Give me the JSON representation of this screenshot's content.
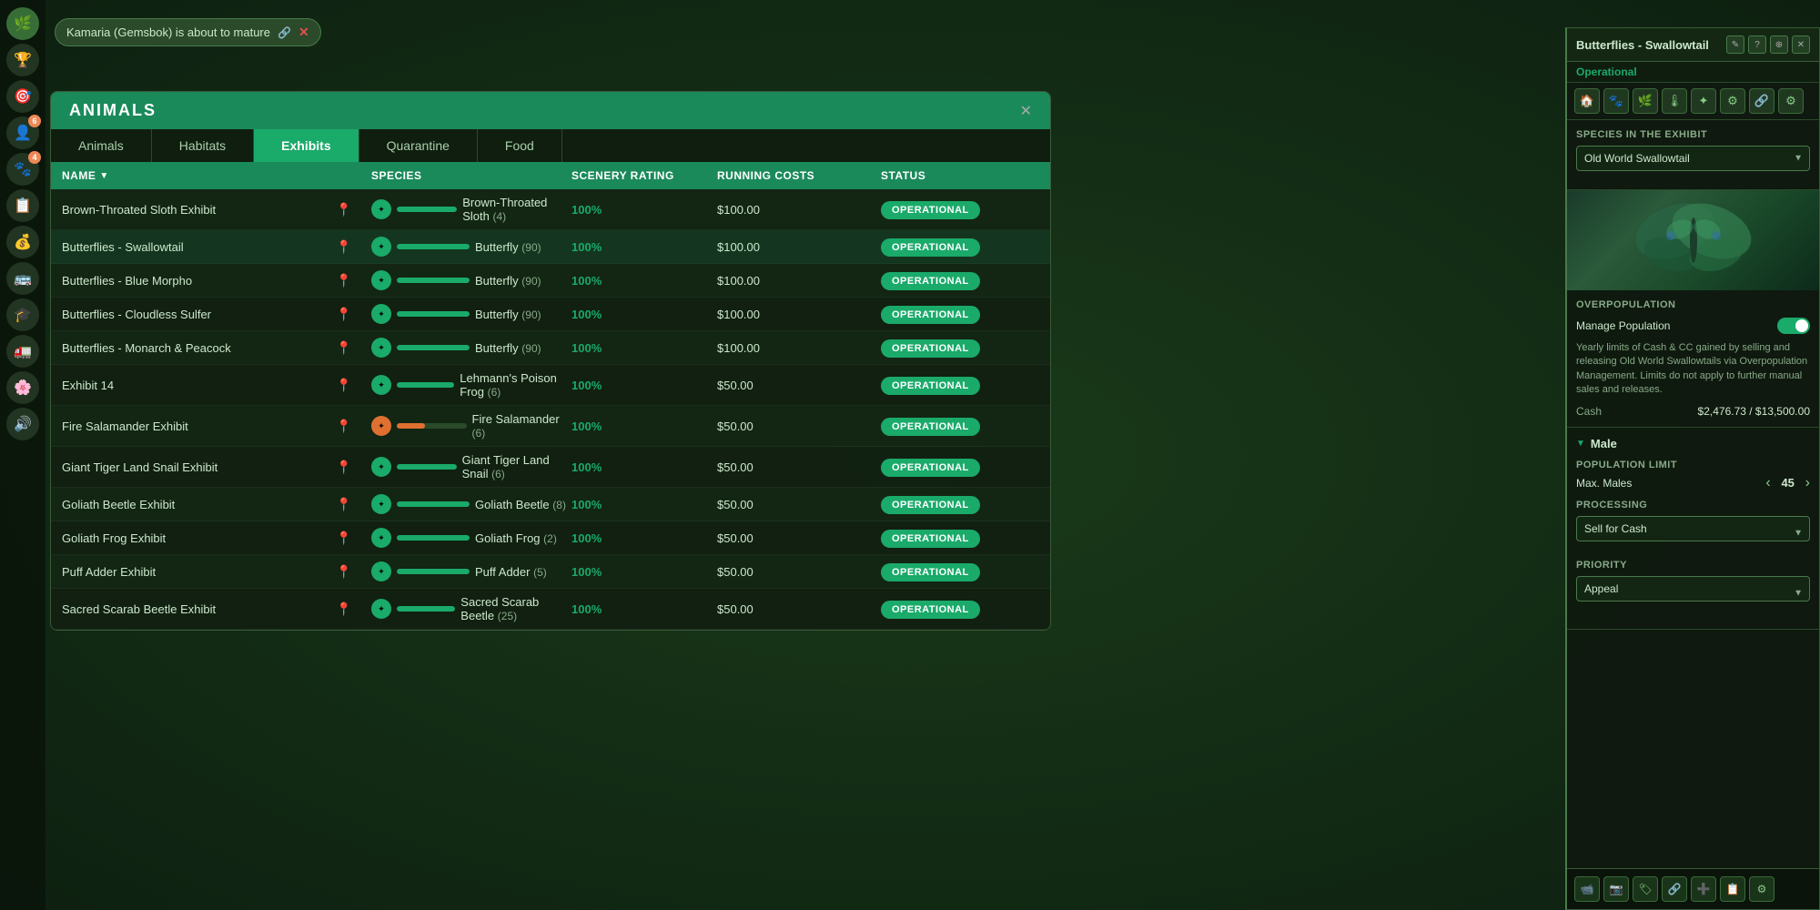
{
  "notification": {
    "text": "Kamaria (Gemsbok) is about to mature",
    "close_label": "✕"
  },
  "animals_panel": {
    "title": "ANIMALS",
    "close_label": "✕",
    "tabs": [
      {
        "label": "Animals",
        "active": false
      },
      {
        "label": "Habitats",
        "active": false
      },
      {
        "label": "Exhibits",
        "active": true
      },
      {
        "label": "Quarantine",
        "active": false
      },
      {
        "label": "Food",
        "active": false
      }
    ],
    "columns": [
      {
        "label": "NAME",
        "sortable": true
      },
      {
        "label": ""
      },
      {
        "label": "SPECIES"
      },
      {
        "label": "SCENERY RATING"
      },
      {
        "label": "RUNNING COSTS"
      },
      {
        "label": "STATUS"
      }
    ],
    "rows": [
      {
        "name": "Brown-Throated Sloth Exhibit",
        "species": "Brown-Throated Sloth",
        "count": 4,
        "scenery": "100%",
        "cost": "$100.00",
        "status": "OPERATIONAL",
        "circle_type": "green",
        "progress": 100
      },
      {
        "name": "Butterflies - Swallowtail",
        "species": "Butterfly",
        "count": 90,
        "scenery": "100%",
        "cost": "$100.00",
        "status": "OPERATIONAL",
        "circle_type": "green",
        "progress": 100,
        "highlighted": true
      },
      {
        "name": "Butterflies - Blue Morpho",
        "species": "Butterfly",
        "count": 90,
        "scenery": "100%",
        "cost": "$100.00",
        "status": "OPERATIONAL",
        "circle_type": "green",
        "progress": 100
      },
      {
        "name": "Butterflies - Cloudless Sulfer",
        "species": "Butterfly",
        "count": 90,
        "scenery": "100%",
        "cost": "$100.00",
        "status": "OPERATIONAL",
        "circle_type": "green",
        "progress": 100
      },
      {
        "name": "Butterflies - Monarch & Peacock",
        "species": "Butterfly",
        "count": 90,
        "scenery": "100%",
        "cost": "$100.00",
        "status": "OPERATIONAL",
        "circle_type": "green",
        "progress": 100
      },
      {
        "name": "Exhibit 14",
        "species": "Lehmann's Poison Frog",
        "count": 6,
        "scenery": "100%",
        "cost": "$50.00",
        "status": "OPERATIONAL",
        "circle_type": "green",
        "progress": 100
      },
      {
        "name": "Fire Salamander Exhibit",
        "species": "Fire Salamander",
        "count": 6,
        "scenery": "100%",
        "cost": "$50.00",
        "status": "OPERATIONAL",
        "circle_type": "orange",
        "progress": 40
      },
      {
        "name": "Giant Tiger Land Snail Exhibit",
        "species": "Giant Tiger Land Snail",
        "count": 6,
        "scenery": "100%",
        "cost": "$50.00",
        "status": "OPERATIONAL",
        "circle_type": "green",
        "progress": 100
      },
      {
        "name": "Goliath Beetle Exhibit",
        "species": "Goliath Beetle",
        "count": 8,
        "scenery": "100%",
        "cost": "$50.00",
        "status": "OPERATIONAL",
        "circle_type": "green",
        "progress": 100
      },
      {
        "name": "Goliath Frog Exhibit",
        "species": "Goliath Frog",
        "count": 2,
        "scenery": "100%",
        "cost": "$50.00",
        "status": "OPERATIONAL",
        "circle_type": "green",
        "progress": 100
      },
      {
        "name": "Puff Adder Exhibit",
        "species": "Puff Adder",
        "count": 5,
        "scenery": "100%",
        "cost": "$50.00",
        "status": "OPERATIONAL",
        "circle_type": "green",
        "progress": 100
      },
      {
        "name": "Sacred Scarab Beetle Exhibit",
        "species": "Sacred Scarab Beetle",
        "count": 25,
        "scenery": "100%",
        "cost": "$50.00",
        "status": "OPERATIONAL",
        "circle_type": "green",
        "progress": 100
      }
    ]
  },
  "right_panel": {
    "title": "Butterflies - Swallowtail",
    "status": "Operational",
    "controls": [
      "✎",
      "?",
      "⊕",
      "✕"
    ],
    "icons": [
      "🏠",
      "🐾",
      "🌿",
      "🌡",
      "☆",
      "⚙",
      "🔗",
      "⚙"
    ],
    "species_section": {
      "title": "SPECIES IN THE EXHIBIT",
      "selected": "Old World Swallowtail"
    },
    "overpopulation": {
      "title": "OVERPOPULATION",
      "toggle_label": "Manage Population",
      "toggle_on": true,
      "description": "Yearly limits of Cash & CC gained by selling and releasing Old World Swallowtails via Overpopulation Management. Limits do not apply to further manual sales and releases.",
      "cash_label": "Cash",
      "cash_value": "$2,476.73 / $13,500.00"
    },
    "male_section": {
      "gender": "Male",
      "pop_limit_title": "POPULATION LIMIT",
      "max_label": "Max. Males",
      "max_value": "45",
      "processing_title": "PROCESSING",
      "processing_value": "Sell for Cash",
      "priority_title": "PRIORITY",
      "priority_value": "Appeal"
    },
    "bottom_tools": [
      "📹",
      "📷",
      "🏷",
      "🔗",
      "➕",
      "📋",
      "⚙"
    ]
  },
  "sidebar": {
    "icons": [
      "🌿",
      "🏆",
      "🎯",
      "👤",
      "🐾",
      "⚙",
      "💰",
      "🚌",
      "🎓",
      "🚛",
      "🌸",
      "🔊"
    ],
    "badges": {
      "1": 6,
      "3": 4
    }
  }
}
